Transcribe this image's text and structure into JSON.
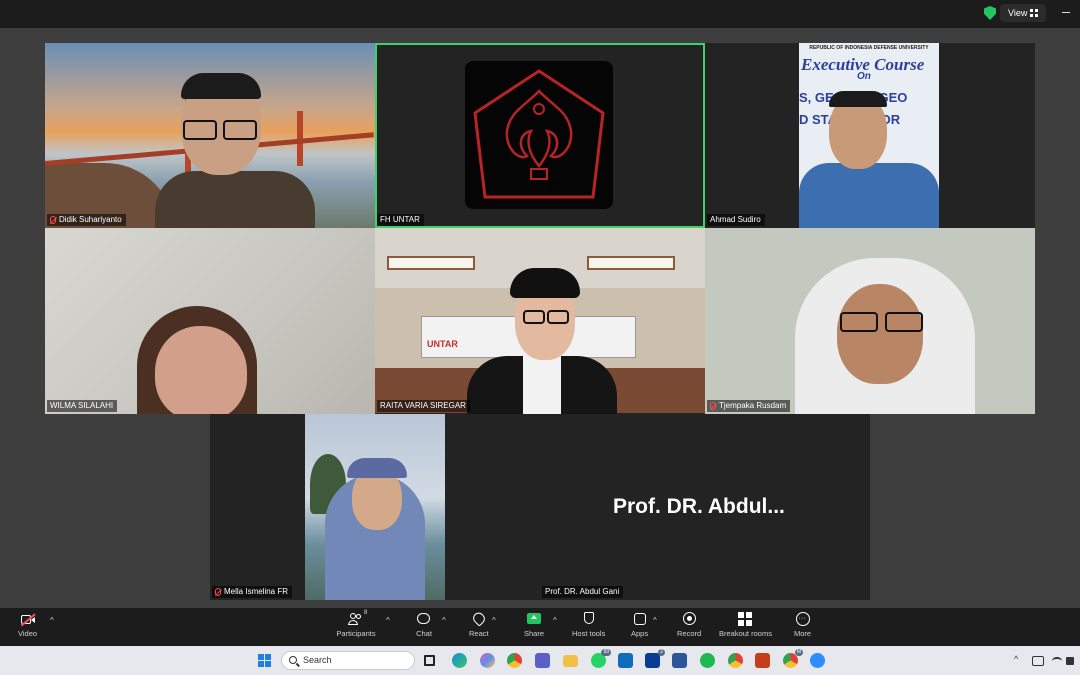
{
  "topbar": {
    "view_label": "View",
    "icons": [
      "shield-check-icon",
      "grid-icon",
      "minimize-icon"
    ],
    "accent": "#22c55e"
  },
  "tiles": [
    {
      "name": "Didik Suhariyanto",
      "muted": true
    },
    {
      "name": "FH UNTAR",
      "muted": false,
      "active": true
    },
    {
      "name": "Ahmad Sudiro",
      "muted": false
    },
    {
      "name": "WILMA SILALAHI",
      "muted": false
    },
    {
      "name": "RAITA VARIA SIREGAR",
      "muted": false
    },
    {
      "name": "Tjempaka Rusdam",
      "muted": true
    },
    {
      "name": "Mella Ismelina FR",
      "muted": true
    },
    {
      "name": "Prof. DR. Abdul Gani",
      "muted": false,
      "display_text": "Prof. DR. Abdul..."
    }
  ],
  "tile3_banner": {
    "top_text": "REPUBLIC OF INDONESIA DEFENSE UNIVERSITY",
    "title": "Executive Course",
    "subtitle": "On",
    "line1": "S, GE    TEGY, GEO",
    "line2": "D STA    T COHOR"
  },
  "tile5_board": {
    "text": "UNTAR"
  },
  "toolbar": {
    "video": "Video",
    "participants": "Participants",
    "participants_count": "8",
    "chat": "Chat",
    "react": "React",
    "share": "Share",
    "host_tools": "Host tools",
    "apps": "Apps",
    "record": "Record",
    "breakout_rooms": "Breakout rooms",
    "more": "More",
    "share_color": "#22c55e"
  },
  "taskbar": {
    "search_placeholder": "Search",
    "badge_whatsapp": "99",
    "badge_l": "2",
    "badge_msg": "M",
    "tray_icons": [
      "chevron-up-icon",
      "network-icon",
      "wifi-icon",
      "speaker-icon"
    ]
  }
}
